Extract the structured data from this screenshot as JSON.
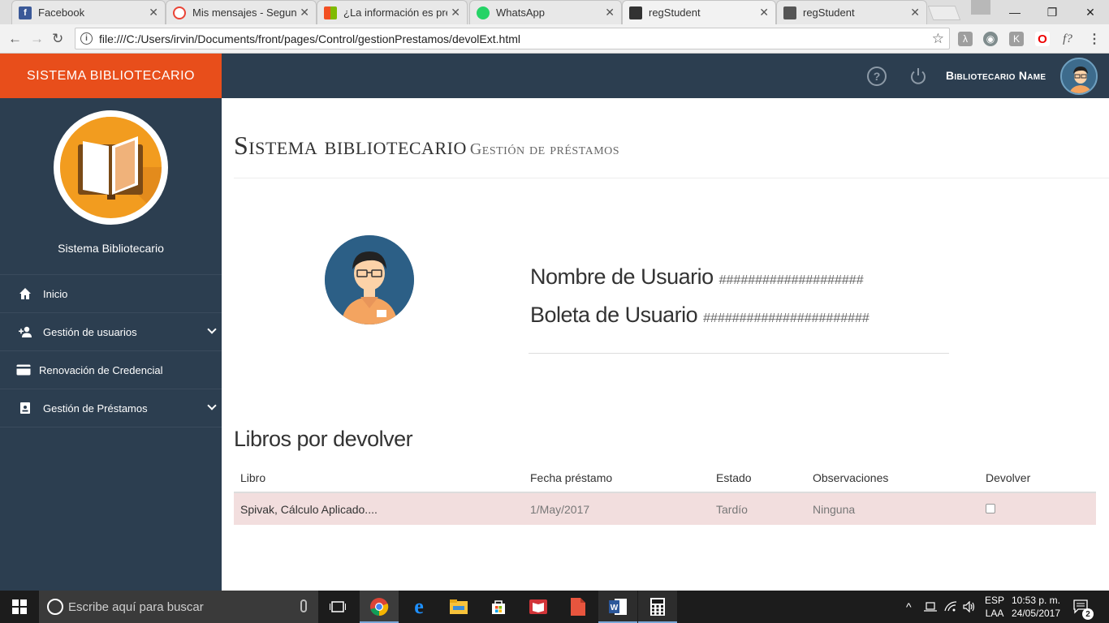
{
  "browser": {
    "tabs": [
      {
        "title": "Facebook",
        "favicon": "facebook-icon",
        "color": "#3b5998"
      },
      {
        "title": "Mis mensajes - Segunda",
        "favicon": "mail-icon",
        "color": "#ea4335"
      },
      {
        "title": "¿La información es prec",
        "favicon": "microsoft-icon",
        "color": "#f25022"
      },
      {
        "title": "WhatsApp",
        "favicon": "whatsapp-icon",
        "color": "#25d366"
      },
      {
        "title": "regStudent",
        "favicon": "page-icon",
        "color": "#333333"
      },
      {
        "title": "regStudent",
        "favicon": "page-icon",
        "color": "#555555"
      }
    ],
    "active_tab_index": 4,
    "url": "file:///C:/Users/irvin/Documents/front/pages/Control/gestionPrestamos/devolExt.html"
  },
  "app": {
    "brand": "Sistema Bibliotecario",
    "user_name": "Bibliotecario Name",
    "sidebar_title": "Sistema Bibliotecario",
    "menu": [
      {
        "label": "Inicio",
        "icon": "home-icon",
        "has_submenu": false
      },
      {
        "label": "Gestión de usuarios",
        "icon": "add-user-icon",
        "has_submenu": true
      },
      {
        "label": "Renovación de Credencial",
        "icon": "credit-card-icon",
        "has_submenu": false
      },
      {
        "label": "Gestión de Préstamos",
        "icon": "book-icon",
        "has_submenu": true
      }
    ],
    "colors": {
      "accent": "#e84e1b",
      "nav": "#2c3e50",
      "late_row": "#f2dede"
    }
  },
  "page": {
    "title": "Sistema bibliotecario",
    "subtitle": "Gestión de préstamos",
    "user_name_label": "Nombre de Usuario",
    "user_name_value": "####################",
    "user_id_label": "Boleta de Usuario",
    "user_id_value": "#######################",
    "section_title": "Libros por devolver",
    "table": {
      "headers": [
        "Libro",
        "Fecha préstamo",
        "Estado",
        "Observaciones",
        "Devolver"
      ],
      "rows": [
        {
          "book": "Spivak, Cálculo Aplicado....",
          "date": "1/May/2017",
          "status": "Tardío",
          "notes": "Ninguna",
          "return_checked": false
        }
      ]
    }
  },
  "taskbar": {
    "search_placeholder": "Escribe aquí para buscar",
    "lang_line1": "ESP",
    "lang_line2": "LAA",
    "time": "10:53 p. m.",
    "date": "24/05/2017",
    "notifications": "2"
  }
}
